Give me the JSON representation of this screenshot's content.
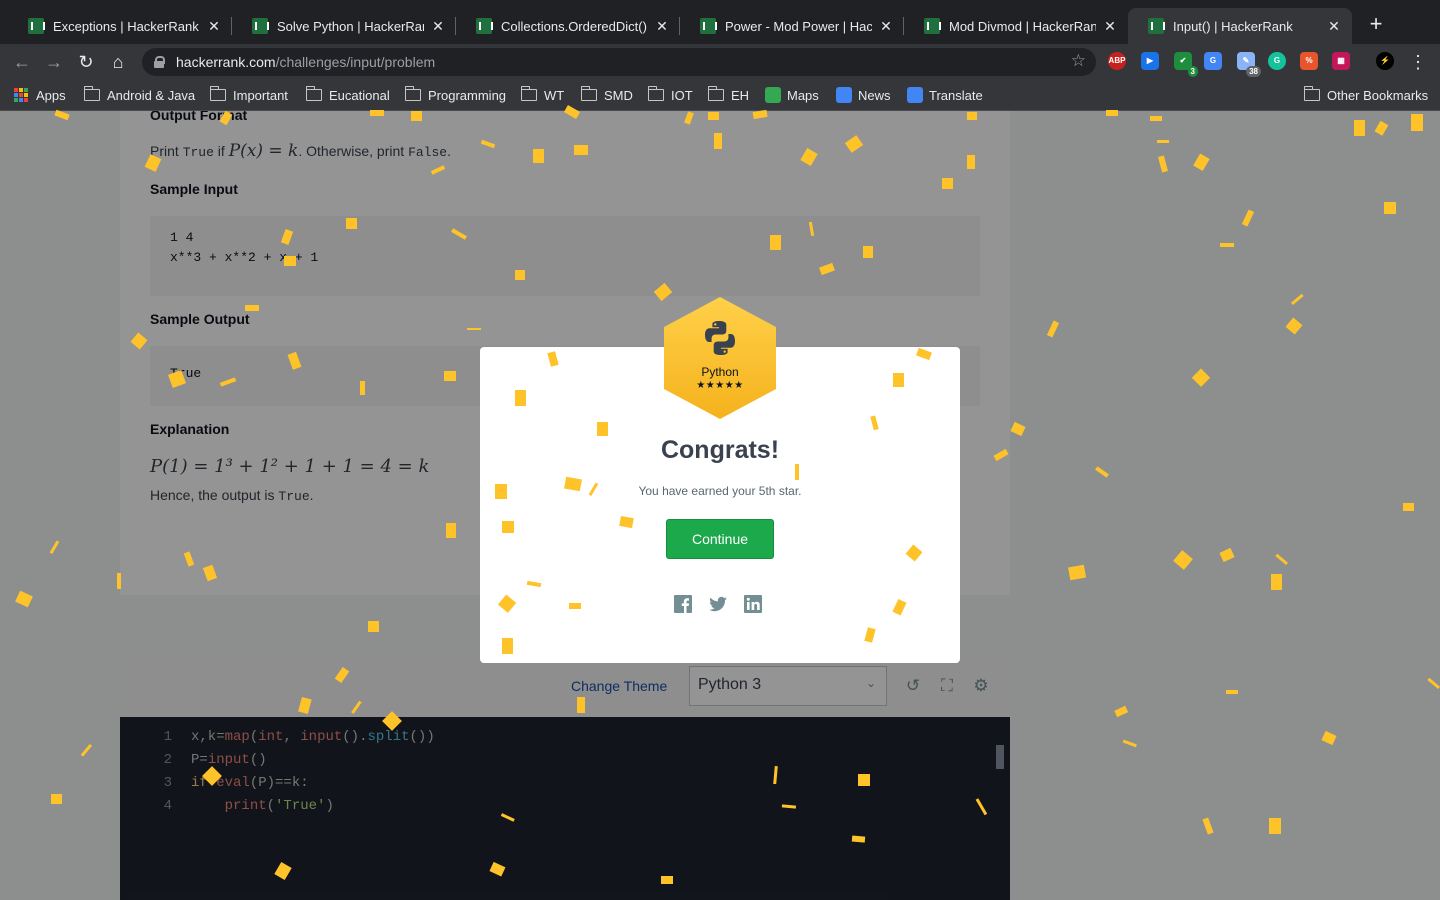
{
  "browser": {
    "tabs": [
      {
        "title": "Exceptions | HackerRank",
        "active": false
      },
      {
        "title": "Solve Python | HackerRank",
        "active": false
      },
      {
        "title": "Collections.OrderedDict() | HackerRank",
        "active": false
      },
      {
        "title": "Power - Mod Power | HackerRank",
        "active": false
      },
      {
        "title": "Mod Divmod | HackerRank",
        "active": false
      },
      {
        "title": "Input() | HackerRank",
        "active": true
      }
    ],
    "new_tab_label": "+",
    "url_host": "hackerrank.com",
    "url_path": "/challenges/input/problem",
    "extensions": {
      "abp_label": "ABP",
      "check_badge": "3",
      "translate_badge": "38"
    },
    "bookmarks": [
      "Apps",
      "Android & Java",
      "Important",
      "Eucational",
      "Programming",
      "WT",
      "SMD",
      "IOT",
      "EH",
      "Maps",
      "News",
      "Translate"
    ],
    "other_bookmarks": "Other Bookmarks"
  },
  "problem": {
    "output_format_heading": "Output Format",
    "output_text_1": "Print",
    "output_true": "True",
    "output_text_2": "if",
    "output_math": "P(x) = k",
    "output_text_3": ". Otherwise, print",
    "output_false": "False",
    "output_text_4": ".",
    "sample_input_heading": "Sample Input",
    "sample_input_lines": [
      "1 4",
      "x**3 + x**2 + x + 1"
    ],
    "sample_output_heading": "Sample Output",
    "sample_output_lines": [
      "True"
    ],
    "explanation_heading": "Explanation",
    "explanation_math": "P(1) = 1³ + 1² + 1 + 1 = 4 = k",
    "hence_text": "Hence, the output is",
    "hence_value": "True",
    "hence_end": "."
  },
  "editor": {
    "change_theme": "Change Theme",
    "language": "Python 3",
    "lines": [
      {
        "n": "1",
        "code": "x,k=map(int, input().split())"
      },
      {
        "n": "2",
        "code": "P=input()"
      },
      {
        "n": "3",
        "code": "if eval(P)==k:"
      },
      {
        "n": "4",
        "code": "    print('True')"
      }
    ]
  },
  "modal": {
    "badge_name": "Python",
    "badge_stars": "★★★★★",
    "title": "Congrats!",
    "message": "You have earned your 5th star.",
    "continue_label": "Continue"
  },
  "colors": {
    "badge_gold": "#ffc32a",
    "continue_green": "#1ba94c",
    "confetti": "#ffc32a"
  },
  "icons": [
    "back-icon",
    "forward-icon",
    "reload-icon",
    "home-icon",
    "lock-icon",
    "star-icon",
    "menu-icon",
    "folder-icon",
    "python-icon",
    "facebook-icon",
    "twitter-icon",
    "linkedin-icon",
    "history-icon",
    "fullscreen-icon",
    "settings-icon"
  ]
}
